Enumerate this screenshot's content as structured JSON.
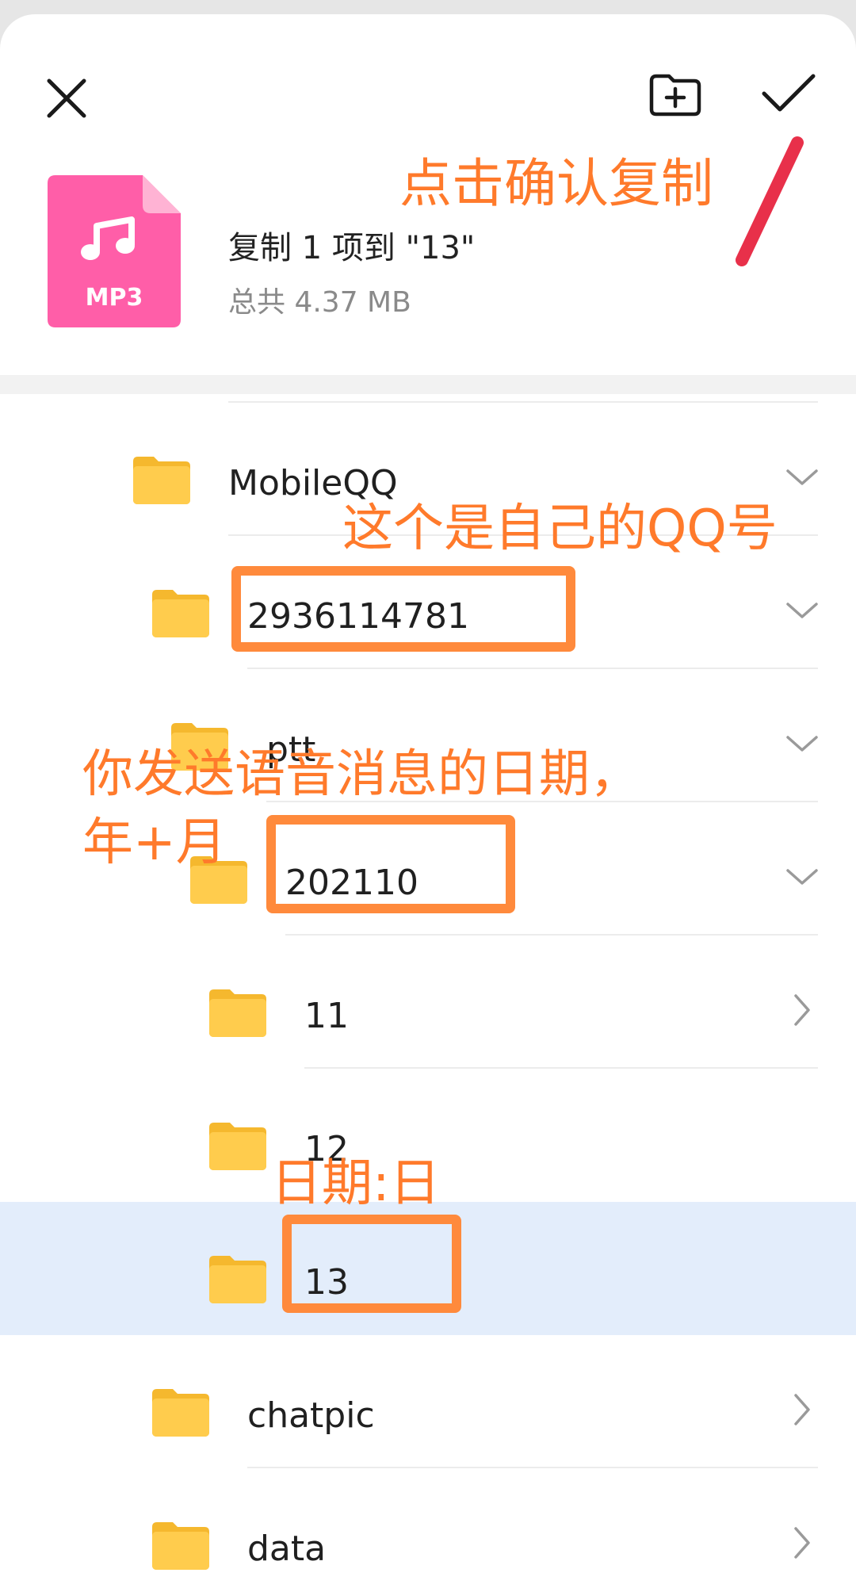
{
  "dialog": {
    "close_icon": "close-icon",
    "new_folder_icon": "new-folder-icon",
    "confirm_icon": "check-icon"
  },
  "file": {
    "icon_label": "MP3",
    "icon_color": "#ff5ea8",
    "title": "复制 1 项到 \"13\"",
    "size": "总共 4.37 MB"
  },
  "tree": {
    "rows": [
      {
        "label": "MobileQQ",
        "chevron": "chevron-down-icon"
      },
      {
        "label": "2936114781",
        "chevron": "chevron-down-icon"
      },
      {
        "label": "ptt",
        "chevron": "chevron-down-icon"
      },
      {
        "label": "202110",
        "chevron": "chevron-down-icon"
      },
      {
        "label": "11",
        "chevron": "chevron-right-icon"
      },
      {
        "label": "12",
        "chevron": "chevron-right-icon"
      },
      {
        "label": "13",
        "chevron": "none",
        "selected": true
      },
      {
        "label": "chatpic",
        "chevron": "chevron-right-icon"
      },
      {
        "label": "data",
        "chevron": "chevron-right-icon"
      }
    ]
  },
  "annotations": {
    "confirm_note": "点击确认复制",
    "qq_note": "这个是自己的QQ号",
    "date_note_line1": "你发送语音消息的日期，",
    "date_note_line2": "年+月",
    "day_note": "日期:日",
    "highlight_color": "#ff8a3c"
  },
  "colors": {
    "folder": "#ffcc4d",
    "folder_tab": "#f5b82e",
    "selected_row": "#e3edfb",
    "annotation_text": "#ff7a2b"
  }
}
